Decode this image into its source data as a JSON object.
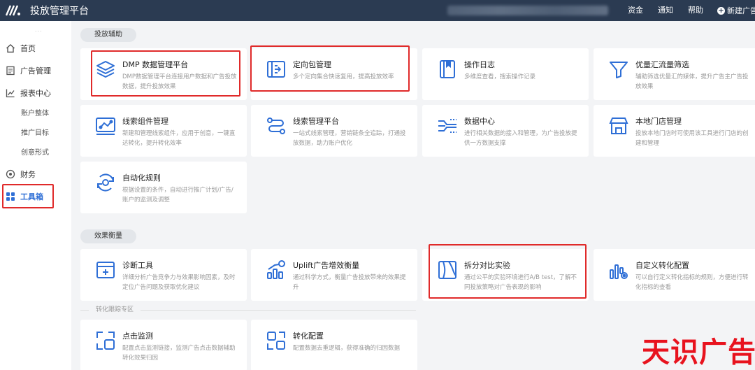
{
  "topbar": {
    "title": "投放管理平台",
    "links": {
      "funds": "资金",
      "notice": "通知",
      "help": "帮助",
      "new": "新建广告"
    }
  },
  "sidebar": {
    "dots": "...",
    "items": [
      {
        "label": "首页",
        "icon": "home-icon"
      },
      {
        "label": "广告管理",
        "icon": "document-icon"
      },
      {
        "label": "报表中心",
        "icon": "chart-icon"
      },
      {
        "label": "账户整体"
      },
      {
        "label": "推广目标"
      },
      {
        "label": "创意形式"
      },
      {
        "label": "财务",
        "icon": "finance-icon"
      },
      {
        "label": "工具箱",
        "icon": "grid-icon",
        "active": true
      }
    ]
  },
  "sections": {
    "s1": "投放辅助",
    "s2": "效果衡量",
    "divider": "转化跟踪专区"
  },
  "cards": [
    {
      "title": "DMP 数据管理平台",
      "desc": "DMP数据管理平台连接用户数据和广告投放数据，提升投放效果",
      "icon": "layers-icon"
    },
    {
      "title": "定向包管理",
      "desc": "多个定向集合快速复用，提高投放效率",
      "icon": "target-package-icon"
    },
    {
      "title": "操作日志",
      "desc": "多维度查看，搜索操作记录",
      "icon": "log-book-icon"
    },
    {
      "title": "优量汇流量筛选",
      "desc": "辅助筛选优量汇的媒体，提升广告主广告投放效果",
      "icon": "funnel-icon"
    },
    {
      "title": "线索组件管理",
      "desc": "新建和管理线索组件，应用于创意，一键直达转化，提升转化效率",
      "icon": "component-icon"
    },
    {
      "title": "线索管理平台",
      "desc": "一站式线索管理，营销链条全追踪，打通投放数据，助力账户优化",
      "icon": "flow-icon"
    },
    {
      "title": "数据中心",
      "desc": "进行相关数据的接入和管理，为广告投放提供一方数据支撑",
      "icon": "data-center-icon"
    },
    {
      "title": "本地门店管理",
      "desc": "投放本地门店时可使用该工具进行门店的创建和管理",
      "icon": "store-icon"
    },
    {
      "title": "自动化规则",
      "desc": "根据设置的条件，自动进行推广计划/广告/账户的监测及调整",
      "icon": "automation-icon"
    },
    {
      "title": "诊断工具",
      "desc": "详细分析广告竞争力与效果影响因素，及时定位广告问题及获取优化建议",
      "icon": "diagnosis-icon"
    },
    {
      "title": "Uplift广告增效衡量",
      "desc": "通过科学方式，衡量广告投放带来的效果提升",
      "icon": "uplift-icon"
    },
    {
      "title": "拆分对比实验",
      "desc": "通过公平的实验环境进行A/B test，了解不同投放策略对广告表现的影响",
      "icon": "split-test-icon"
    },
    {
      "title": "自定义转化配置",
      "desc": "可以自行定义转化指标的规则，方便进行转化指标的查看",
      "icon": "custom-conversion-icon"
    },
    {
      "title": "点击监测",
      "desc": "配置点击监测链接，监测广告点击数据辅助转化效果归因",
      "icon": "click-monitor-icon"
    },
    {
      "title": "转化配置",
      "desc": "配置数据去重逻辑，获得准确的归因数据",
      "icon": "conversion-config-icon"
    }
  ],
  "watermark": "天识广告",
  "colors": {
    "topbar": "#2b3b52",
    "accent": "#2f6fd6",
    "highlight": "#e02a2a",
    "watermark": "#e8131e"
  }
}
